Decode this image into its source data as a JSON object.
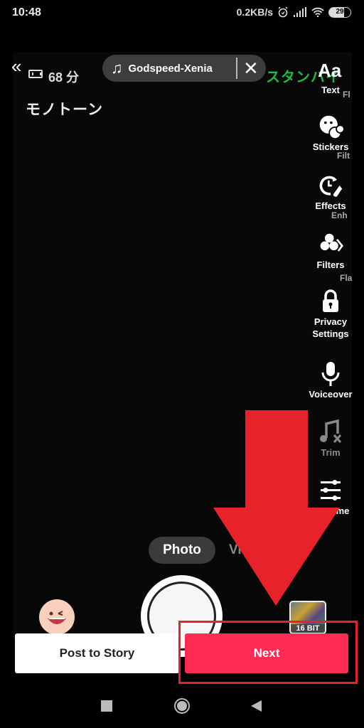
{
  "status_bar": {
    "time": "10:48",
    "net_speed": "0.2KB/s",
    "battery": "29",
    "icons": [
      "alarm-icon",
      "signal-icon",
      "wifi-icon",
      "battery-icon"
    ]
  },
  "overlay": {
    "back_glyph": "«",
    "minutes": "68 分",
    "mono_text": "モノトーン",
    "standby_text": "スタンバイ"
  },
  "sound": {
    "icon": "music-note-icon",
    "title": "Godspeed-Xenia",
    "close_glyph": "✕"
  },
  "tools": [
    {
      "icon": "text-icon",
      "label": "Text",
      "ghost": "Fl"
    },
    {
      "icon": "stickers-icon",
      "label": "Stickers",
      "ghost": "Filt"
    },
    {
      "icon": "effects-icon",
      "label": "Effects",
      "ghost": "Enh"
    },
    {
      "icon": "filters-icon",
      "label": "Filters",
      "ghost": "Fla"
    },
    {
      "icon": "lock-icon",
      "label": "Privacy\nSettings"
    },
    {
      "icon": "microphone-icon",
      "label": "Voiceover"
    },
    {
      "icon": "trim-music-icon",
      "label": "Trim"
    },
    {
      "icon": "sliders-icon",
      "label": "Volume",
      "visible_text": "me"
    }
  ],
  "modes": {
    "active": "Photo",
    "inactive_partial": "Vi"
  },
  "thumbnail": {
    "label": "16 BIT"
  },
  "buttons": {
    "post_to_story": "Post to Story",
    "next": "Next"
  },
  "annotation": {
    "arrow_color": "#e8222a",
    "highlight_target": "next-button"
  },
  "colors": {
    "next_accent": "#fe2c55",
    "standby_green": "#1db84a"
  },
  "nav_bar": {
    "items": [
      "recents-button",
      "home-button",
      "back-button"
    ]
  }
}
